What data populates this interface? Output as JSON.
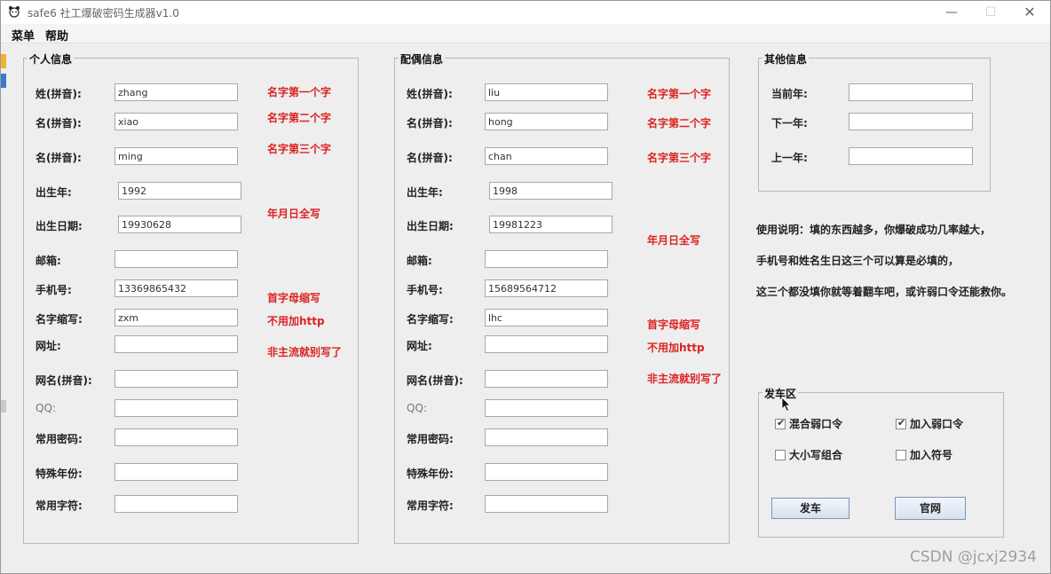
{
  "window": {
    "title": "safe6 社工爆破密码生成器v1.0",
    "minimize_glyph": "—",
    "maximize_glyph": "☐",
    "close_glyph": "✕"
  },
  "menu": {
    "items": [
      "菜单",
      "帮助"
    ]
  },
  "personal": {
    "legend": "个人信息",
    "fields": [
      {
        "label": "姓(拼音):",
        "value": "zhang"
      },
      {
        "label": "名(拼音):",
        "value": "xiao"
      },
      {
        "label": "名(拼音):",
        "value": "ming"
      },
      {
        "label": "出生年:",
        "value": "1992"
      },
      {
        "label": "出生日期:",
        "value": "19930628"
      },
      {
        "label": "邮箱:",
        "value": ""
      },
      {
        "label": "手机号:",
        "value": "13369865432"
      },
      {
        "label": "名字缩写:",
        "value": "zxm"
      },
      {
        "label": "网址:",
        "value": ""
      },
      {
        "label": "网名(拼音):",
        "value": ""
      },
      {
        "label": "QQ:",
        "value": ""
      },
      {
        "label": "常用密码:",
        "value": ""
      },
      {
        "label": "特殊年份:",
        "value": ""
      },
      {
        "label": "常用字符:",
        "value": ""
      }
    ],
    "hints": [
      "名字第一个字",
      "名字第二个字",
      "名字第三个字",
      "年月日全写",
      "首字母缩写",
      "不用加http",
      "非主流就别写了"
    ]
  },
  "spouse": {
    "legend": "配偶信息",
    "fields": [
      {
        "label": "姓(拼音):",
        "value": "liu"
      },
      {
        "label": "名(拼音):",
        "value": "hong"
      },
      {
        "label": "名(拼音):",
        "value": "chan"
      },
      {
        "label": "出生年:",
        "value": "1998"
      },
      {
        "label": "出生日期:",
        "value": "19981223"
      },
      {
        "label": "邮箱:",
        "value": ""
      },
      {
        "label": "手机号:",
        "value": "15689564712"
      },
      {
        "label": "名字缩写:",
        "value": "lhc"
      },
      {
        "label": "网址:",
        "value": ""
      },
      {
        "label": "网名(拼音):",
        "value": ""
      },
      {
        "label": "QQ:",
        "value": ""
      },
      {
        "label": "常用密码:",
        "value": ""
      },
      {
        "label": "特殊年份:",
        "value": ""
      },
      {
        "label": "常用字符:",
        "value": ""
      }
    ],
    "hints": [
      "名字第一个字",
      "名字第二个字",
      "名字第三个字",
      "年月日全写",
      "首字母缩写",
      "不用加http",
      "非主流就别写了"
    ]
  },
  "other": {
    "legend": "其他信息",
    "fields": [
      {
        "label": "当前年:",
        "value": ""
      },
      {
        "label": "下一年:",
        "value": ""
      },
      {
        "label": "上一年:",
        "value": ""
      }
    ]
  },
  "usage": [
    "使用说明：填的东西越多，你爆破成功几率越大，",
    "手机号和姓名生日这三个可以算是必填的，",
    "这三个都没填你就等着翻车吧，或许弱口令还能救你。"
  ],
  "fire": {
    "legend": "发车区",
    "options": [
      {
        "label": "混合弱口令",
        "checked": true
      },
      {
        "label": "加入弱口令",
        "checked": true
      },
      {
        "label": "大小写组合",
        "checked": false
      },
      {
        "label": "加入符号",
        "checked": false
      }
    ],
    "buttons": {
      "go": "发车",
      "site": "官网"
    }
  },
  "watermark": "CSDN @jcxj2934"
}
